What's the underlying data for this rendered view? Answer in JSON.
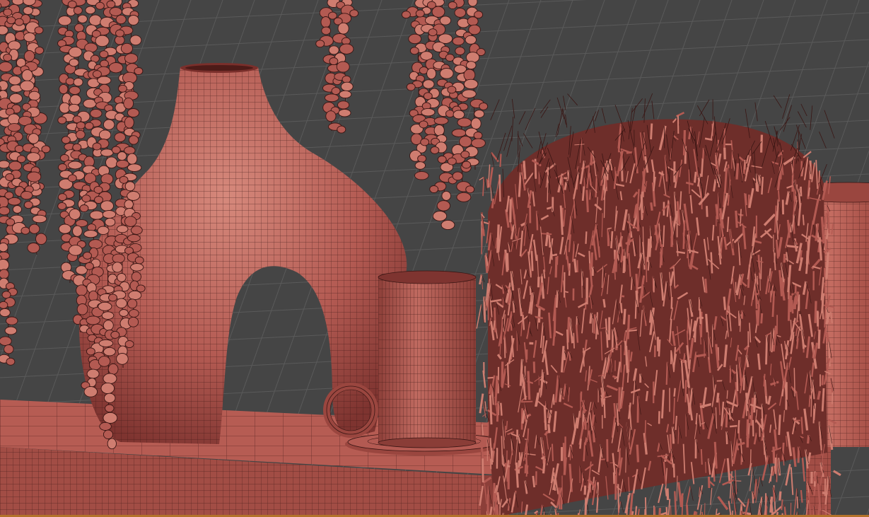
{
  "viewport": {
    "background_color": "#454545",
    "grid_line_color": "#5a5a5a",
    "object_fill_color": "#b35a52",
    "object_highlight_color": "#cf7d70",
    "wire_color": "#3a1614",
    "shadow_color": "#6e2e2a",
    "bottom_edge_color": "#b4722a"
  },
  "scene_objects": [
    {
      "id": "hanging-beads-left",
      "kind": "beaded strands"
    },
    {
      "id": "vase",
      "kind": "arched vase"
    },
    {
      "id": "cup",
      "kind": "cylindrical cup with ring handle"
    },
    {
      "id": "saucer",
      "kind": "saucer"
    },
    {
      "id": "shelf",
      "kind": "shelf slab"
    },
    {
      "id": "fur-plant",
      "kind": "shaggy foliage"
    },
    {
      "id": "planter",
      "kind": "cylindrical planter"
    },
    {
      "id": "hanging-beads-center",
      "kind": "beaded strands"
    }
  ]
}
